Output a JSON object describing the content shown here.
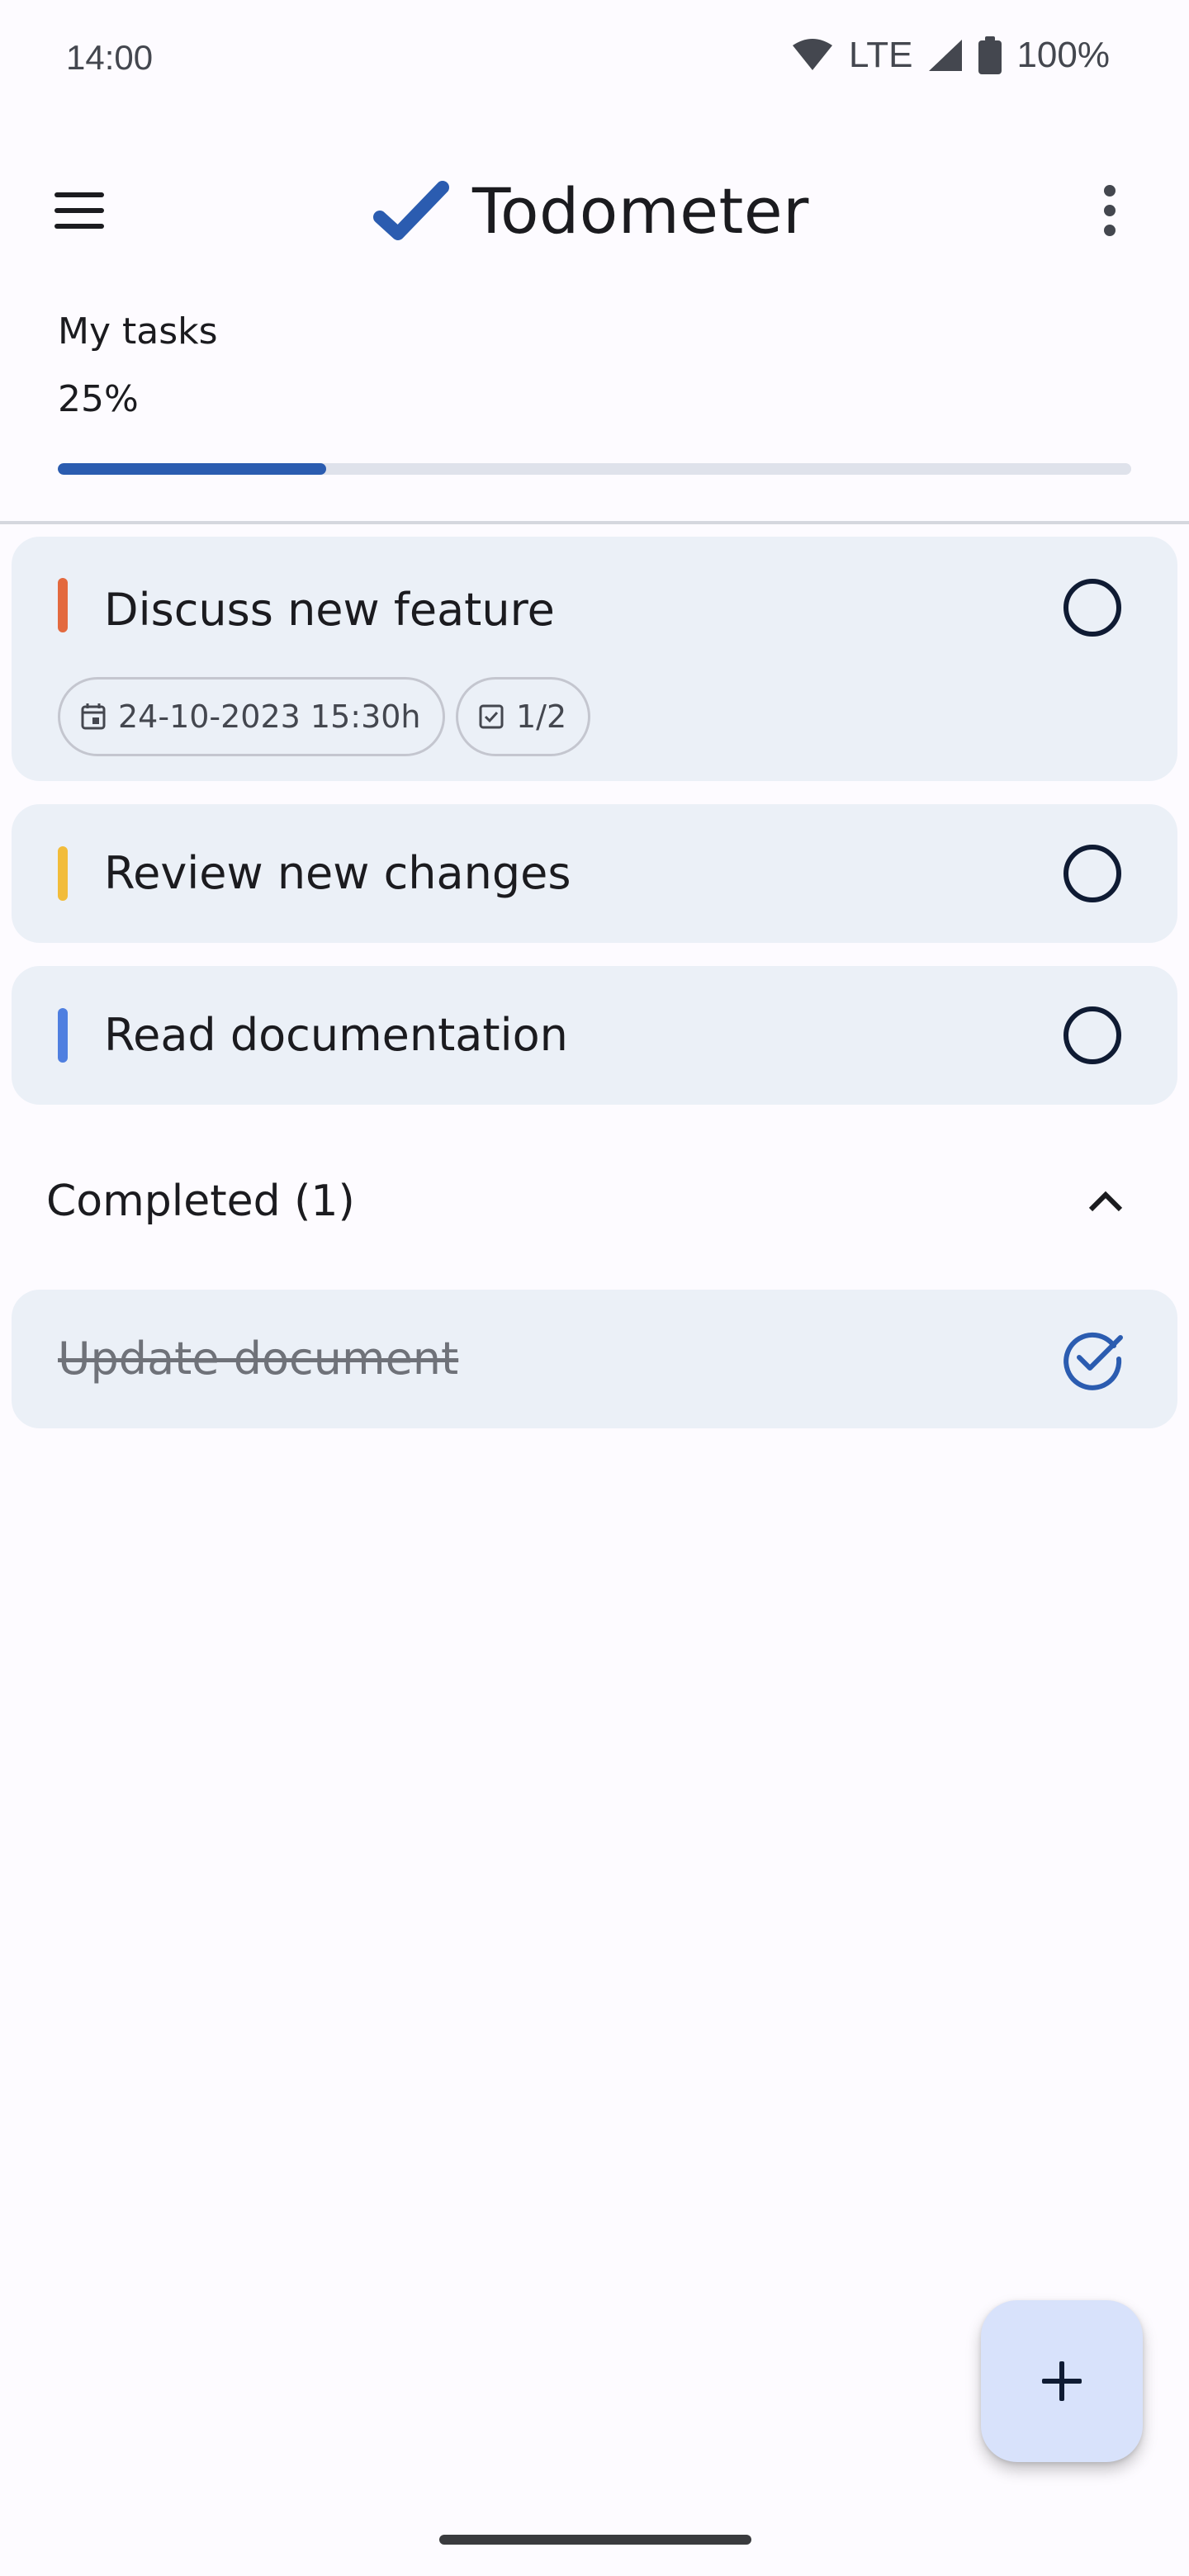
{
  "status_bar": {
    "time": "14:00",
    "network": "LTE",
    "battery": "100%"
  },
  "app_bar": {
    "title": "Todometer",
    "menu_icon": "hamburger-menu-icon",
    "logo_icon": "checkmark-logo-icon",
    "more_icon": "more-vertical-icon"
  },
  "progress": {
    "label": "My tasks",
    "percent_text": "25%",
    "fraction": 0.25
  },
  "tasks": [
    {
      "title": "Discuss new feature",
      "marker_color": "#e3693e",
      "date_chip": "24-10-2023 15:30h",
      "checklist_chip": "1/2",
      "done": false
    },
    {
      "title": "Review new changes",
      "marker_color": "#f2bc3a",
      "done": false
    },
    {
      "title": "Read documentation",
      "marker_color": "#4f7fe0",
      "done": false
    }
  ],
  "completed": {
    "label": "Completed (1)",
    "expanded": true,
    "items": [
      {
        "title": "Update document",
        "done": true
      }
    ]
  },
  "fab": {
    "icon": "plus-icon"
  },
  "colors": {
    "accent": "#2b5cb0",
    "card_background": "#ebf0f7",
    "fab_background": "#d8e2fb"
  }
}
